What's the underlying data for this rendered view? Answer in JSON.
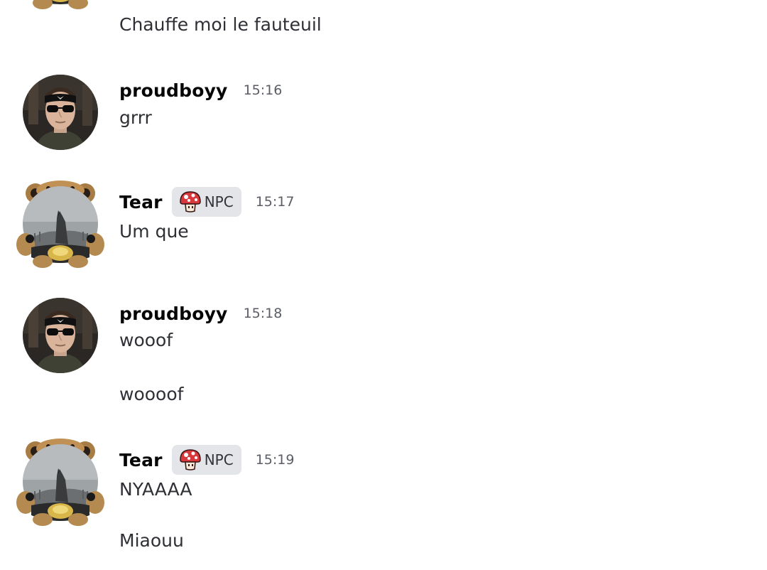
{
  "messages": [
    {
      "author": "",
      "lines": [
        "Chauffe moi le fauteuil"
      ]
    },
    {
      "author": "proudboyy",
      "time": "15:16",
      "avatar_icon": "man-sunglasses-bandana-avatar",
      "lines": [
        "grrr"
      ]
    },
    {
      "author": "Tear",
      "role": "NPC",
      "role_icon": "red-mushroom-icon",
      "time": "15:17",
      "avatar_icon": "bear-frame-wolf-avatar",
      "lines": [
        "Um que"
      ]
    },
    {
      "author": "proudboyy",
      "time": "15:18",
      "avatar_icon": "man-sunglasses-bandana-avatar",
      "lines": [
        "wooof",
        "woooof"
      ]
    },
    {
      "author": "Tear",
      "role": "NPC",
      "role_icon": "red-mushroom-icon",
      "time": "15:19",
      "avatar_icon": "bear-frame-wolf-avatar",
      "lines": [
        "NYAAAA",
        "Miaouu"
      ]
    }
  ],
  "colors": {
    "background": "#ffffff",
    "username": "#060607",
    "message_text": "#2e3035",
    "timestamp": "#5c5e66",
    "role_badge_bg": "#e3e5e8",
    "mushroom_red": "#d9393c"
  }
}
